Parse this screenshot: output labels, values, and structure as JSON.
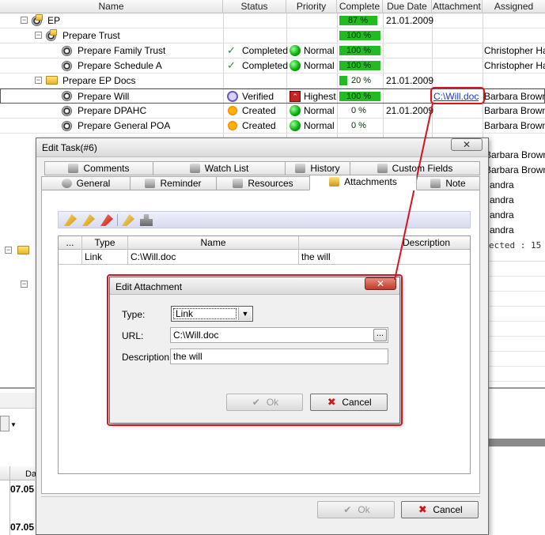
{
  "grid": {
    "columns": [
      "Name",
      "Status",
      "Priority",
      "Complete",
      "Due Date",
      "Attachment",
      "Assigned"
    ],
    "rows": [
      {
        "name": "EP",
        "status": "",
        "priority": "",
        "complete": "87 %",
        "due": "21.01.2009",
        "attachment": "",
        "assigned": ""
      },
      {
        "name": "Prepare Trust",
        "status": "",
        "priority": "",
        "complete": "100 %",
        "due": "",
        "attachment": "",
        "assigned": ""
      },
      {
        "name": "Prepare Family Trust",
        "status": "Completed",
        "priority": "Normal",
        "complete": "100 %",
        "due": "",
        "attachment": "",
        "assigned": "Christopher Hall"
      },
      {
        "name": "Prepare Schedule A",
        "status": "Completed",
        "priority": "Normal",
        "complete": "100 %",
        "due": "",
        "attachment": "",
        "assigned": "Christopher Hall"
      },
      {
        "name": "Prepare EP Docs",
        "status": "",
        "priority": "",
        "complete": "20 %",
        "due": "21.01.2009",
        "attachment": "",
        "assigned": ""
      },
      {
        "name": "Prepare Will",
        "status": "Verified",
        "priority": "Highest",
        "complete": "100 %",
        "due": "",
        "attachment": "C:\\Will.doc",
        "assigned": "Barbara Brown"
      },
      {
        "name": "Prepare DPAHC",
        "status": "Created",
        "priority": "Normal",
        "complete": "0 %",
        "due": "21.01.2009",
        "attachment": "",
        "assigned": "Barbara Brown"
      },
      {
        "name": "Prepare General POA",
        "status": "Created",
        "priority": "Normal",
        "complete": "0 %",
        "due": "",
        "attachment": "",
        "assigned": "Barbara Brown"
      }
    ],
    "hidden_assigned": [
      "Barbara Brown",
      "Barbara Brown",
      "andra",
      "andra",
      "andra",
      "andra"
    ],
    "selected_text": "ected : 15",
    "lower_left_values": [
      "07.05",
      "07.05"
    ],
    "lower_left_header": "Da"
  },
  "edit_task": {
    "title": "Edit Task(#6)",
    "close_glyph": "✕",
    "tabs_row1": [
      "Comments",
      "Watch List",
      "History",
      "Custom Fields"
    ],
    "tabs_row2": [
      "General",
      "Reminder",
      "Resources",
      "Attachments",
      "Note"
    ],
    "active_tab": "Attachments",
    "attach_columns": [
      "...",
      "Type",
      "Name",
      "Description"
    ],
    "attachments": [
      {
        "type": "Link",
        "name": "C:\\Will.doc",
        "description": "the will"
      }
    ],
    "ok_label": "Ok",
    "cancel_label": "Cancel"
  },
  "edit_attachment": {
    "title": "Edit Attachment",
    "close_glyph": "✕",
    "type_label": "Type:",
    "type_value": "Link",
    "url_label": "URL:",
    "url_value": "C:\\Will.doc",
    "browse_glyph": "...",
    "description_label": "Description:",
    "description_value": "the will",
    "ok_label": "Ok",
    "cancel_label": "Cancel"
  },
  "colors": {
    "annotation": "#d4141f",
    "progress": "#22bb22",
    "link": "#1a3ad8"
  }
}
